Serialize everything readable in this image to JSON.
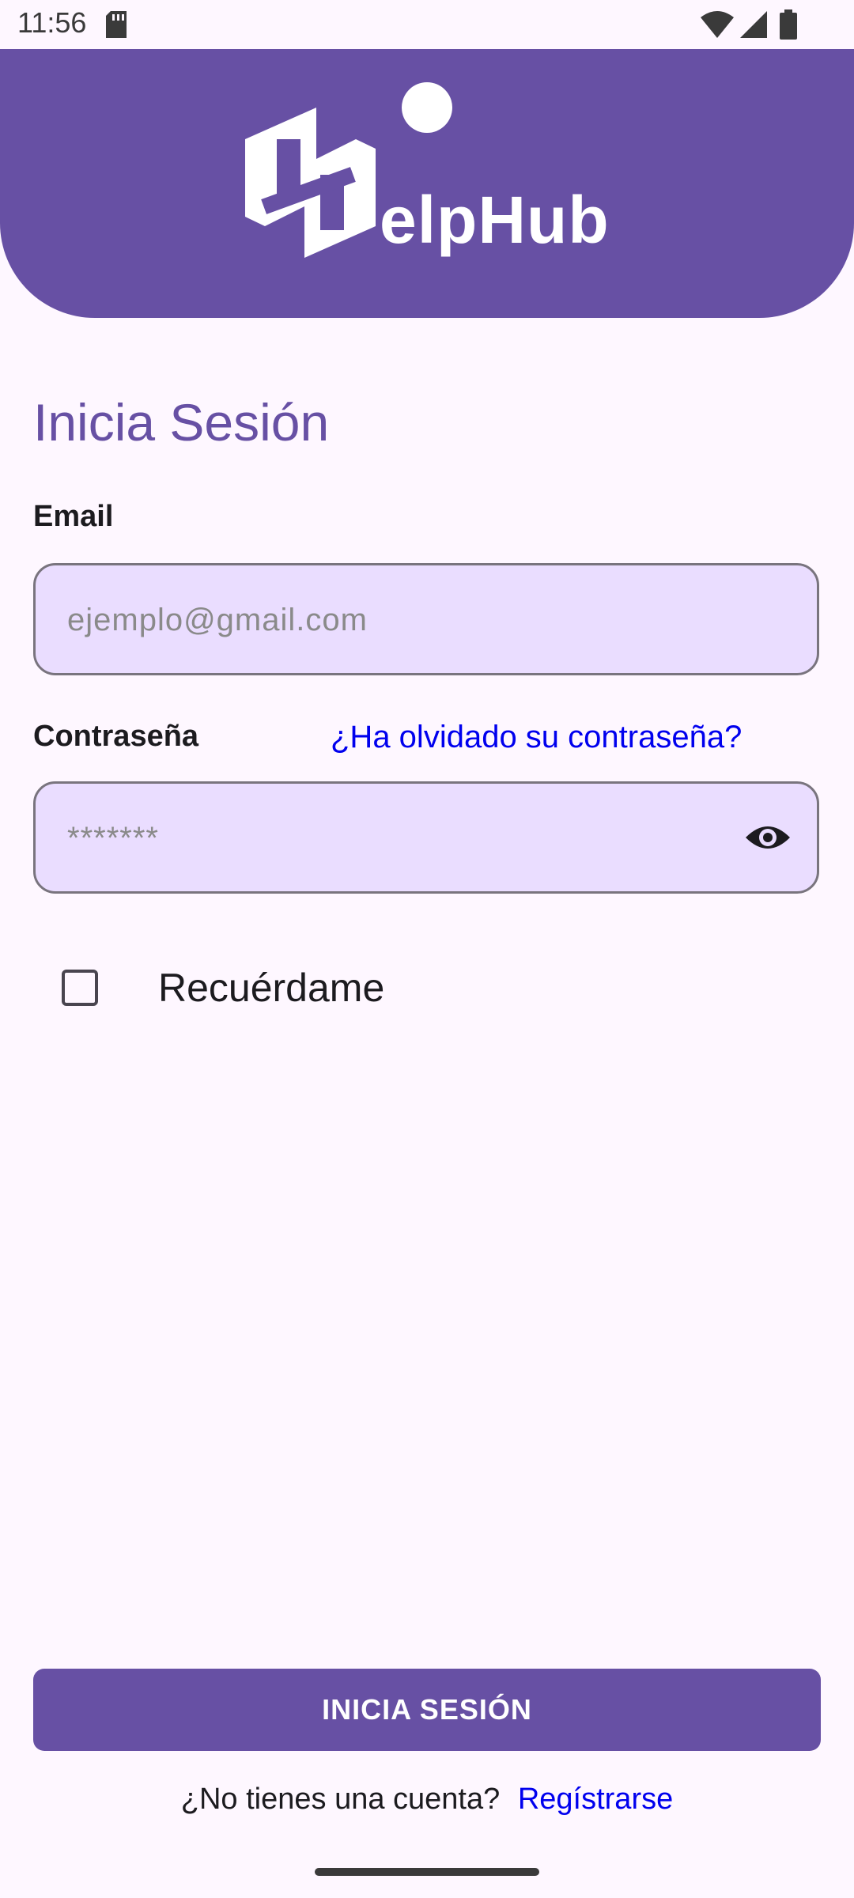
{
  "status_bar": {
    "time": "11:56",
    "icons": [
      "sd-card-icon",
      "wifi-icon",
      "signal-icon",
      "battery-icon"
    ]
  },
  "header": {
    "brand_text": "elpHub",
    "brand_color": "#6750A4",
    "logo": "helphub-logo"
  },
  "login": {
    "title": "Inicia Sesión",
    "email_label": "Email",
    "email_placeholder": "ejemplo@gmail.com",
    "email_value": "",
    "password_label": "Contraseña",
    "password_placeholder": "*******",
    "password_value": "",
    "forgot_password": "¿Ha olvidado su contraseña?",
    "remember_me": "Recuérdame",
    "remember_me_checked": false,
    "submit": "INICIA SESIÓN",
    "no_account": "¿No tienes una cuenta?",
    "register": "Regístrarse"
  },
  "colors": {
    "primary": "#6750A4",
    "field_background": "#EADDFF",
    "link": "#0000EE",
    "background": "#FEF7FF"
  }
}
